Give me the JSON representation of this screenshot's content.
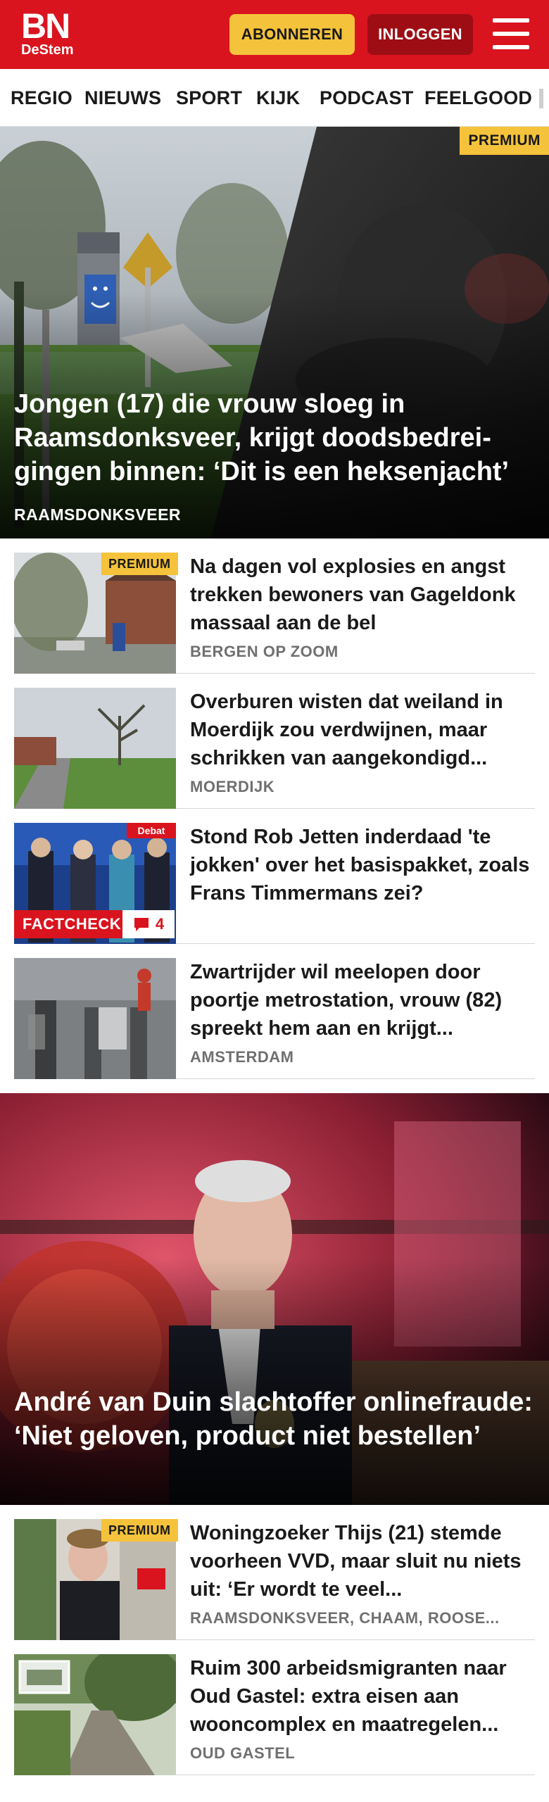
{
  "header": {
    "logo_main": "BN",
    "logo_sub": "DeStem",
    "subscribe_label": "ABONNEREN",
    "login_label": "INLOGGEN",
    "menu_icon": "hamburger-menu-icon"
  },
  "nav": {
    "items": [
      "REGIO",
      "NIEUWS",
      "SPORT",
      "KIJK",
      "PODCAST",
      "FEELGOOD"
    ]
  },
  "hero1": {
    "badge": "PREMIUM",
    "title": "Jongen (17) die vrouw sloeg in Raamsdonksveer, krijgt doodsbedrei­gingen binnen: ‘Dit is een heksenjacht’",
    "tag": "RAAMSDONKSVEER"
  },
  "articles": [
    {
      "badge": "PREMIUM",
      "title": "Na dagen vol explosies en angst trekken bewoners van Gageldonk massaal aan de bel",
      "tag": "BERGEN OP ZOOM"
    },
    {
      "title": "Overburen wisten dat weiland in Moerdijk zou verdwijnen, maar schrikken van aangekondigd...",
      "tag": "MOERDIJK"
    },
    {
      "title": "Stond Rob Jetten inderdaad 'te jokken' over het basispakket, zoals Frans Timmermans zei?",
      "factcheck": "FACTCHECK",
      "comment_count": "4",
      "thumb_label": "Debat"
    },
    {
      "title": "Zwartrijder wil meelopen door poortje metrostation, vrouw (82) spreekt hem aan en krijgt...",
      "tag": "AMSTERDAM"
    }
  ],
  "hero2": {
    "title": "André van Duin slachtoffer onlinefraude: ‘Niet geloven, product niet bestellen’"
  },
  "articles2": [
    {
      "badge": "PREMIUM",
      "title": "Woningzoeker Thijs (21) stemde voorheen VVD, maar sluit nu niets uit: ‘Er wordt te veel...",
      "tag": "RAAMSDONKSVEER, CHAAM, ROOSE..."
    },
    {
      "title": "Ruim 300 arbeidsmigranten naar Oud Gastel: extra eisen aan wooncomplex en maatregelen...",
      "tag": "OUD GASTEL"
    }
  ],
  "colors": {
    "brand_red": "#d9141e",
    "premium_yellow": "#f5c33b",
    "login_dark_red": "#9e0d14",
    "tag_grey": "#707070"
  }
}
